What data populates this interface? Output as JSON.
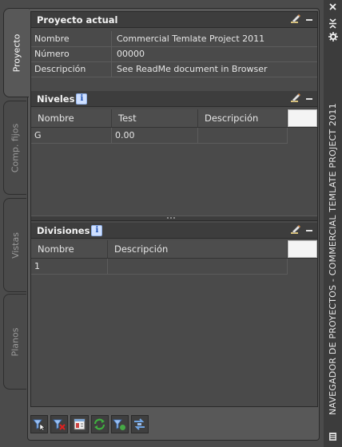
{
  "tabs": [
    "Proyecto",
    "Comp. fijos",
    "Vistas",
    "Planos"
  ],
  "current_project": {
    "title": "Proyecto actual",
    "rows": [
      {
        "label": "Nombre",
        "value": "Commercial Temlate Project  2011"
      },
      {
        "label": "Número",
        "value": "00000"
      },
      {
        "label": "Descripción",
        "value": "See ReadMe document in Browser"
      }
    ]
  },
  "levels": {
    "title": "Niveles",
    "columns": [
      "Nombre",
      "Test",
      "Descripción"
    ],
    "rows": [
      [
        "G",
        "0.00",
        ""
      ]
    ]
  },
  "divisions": {
    "title": "Divisiones",
    "columns": [
      "Nombre",
      "Descripción"
    ],
    "rows": [
      [
        "1",
        ""
      ]
    ]
  },
  "palette_title": "NAVEGADOR DE PROYECTOS - COMMERCIAL TEMLATE PROJECT  2011",
  "icons": {
    "info": "info-icon",
    "edit": "edit-icon",
    "minimize": "minimize-icon",
    "toolbar": [
      "select-project-icon",
      "close-project-icon",
      "project-browser-icon",
      "refresh-icon",
      "reset-view-icon",
      "sync-icon"
    ]
  },
  "colors": {
    "panel": "#585858",
    "background": "#4b4b4b",
    "header": "#3d3d3d",
    "text": "#e6e6e6"
  }
}
